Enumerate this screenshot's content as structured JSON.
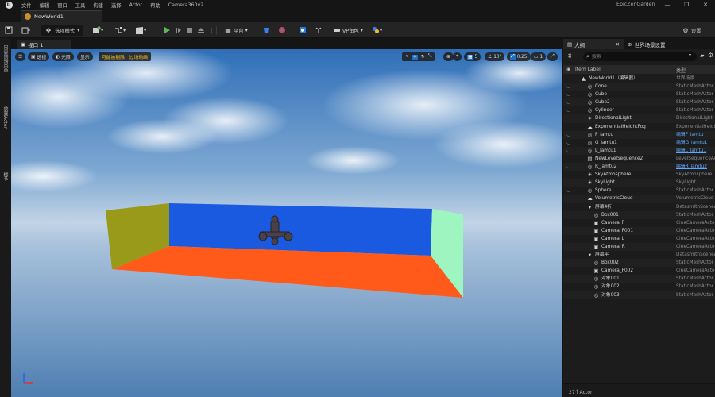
{
  "menubar": {
    "logo": "U",
    "items": [
      "文件",
      "编辑",
      "窗口",
      "工具",
      "构建",
      "选择",
      "Actor",
      "帮助",
      "Camera360v2"
    ],
    "project_name": "EpicZenGarden",
    "window_buttons": [
      "—",
      "❐",
      "✕"
    ]
  },
  "level_tab": {
    "label": "NewWorld1"
  },
  "toolbar": {
    "mode_label": "选项模式",
    "platform_label": "平台",
    "vp_label": "VP角色",
    "settings_label": "设置"
  },
  "left_panel": {
    "tabs": [
      "内容侧滑菜单",
      "放置Actor",
      "细节"
    ]
  },
  "viewport": {
    "tab_label": "视口 1",
    "perspective_label": "透视",
    "lit_label": "光照",
    "show_label": "显示",
    "warning_label": "可能被剔除：过场动画",
    "grid_value": "5",
    "angle_value": "10°",
    "scale_value": "0.25",
    "camera_speed": "1"
  },
  "outliner": {
    "tab_label": "大纲",
    "world_settings_tab": "世界场景设置",
    "search_placeholder": "搜索",
    "col_label": "Item Label",
    "col_type": "类型",
    "rows": [
      {
        "name": "NewWorld1（编辑器）",
        "type": "世界场景",
        "indent": 1,
        "eye": false,
        "icon": "▲",
        "link": false
      },
      {
        "name": "Cone",
        "type": "StaticMeshActor",
        "indent": 2,
        "eye": true,
        "icon": "◎",
        "link": false
      },
      {
        "name": "Cube",
        "type": "StaticMeshActor",
        "indent": 2,
        "eye": true,
        "icon": "◎",
        "link": false
      },
      {
        "name": "Cube2",
        "type": "StaticMeshActor",
        "indent": 2,
        "eye": true,
        "icon": "◎",
        "link": false
      },
      {
        "name": "Cylinder",
        "type": "StaticMeshActor",
        "indent": 2,
        "eye": true,
        "icon": "◎",
        "link": false
      },
      {
        "name": "DirectionalLight",
        "type": "DirectionalLight",
        "indent": 2,
        "eye": false,
        "icon": "✶",
        "link": false
      },
      {
        "name": "ExponentialHeightFog",
        "type": "ExponentialHeigh",
        "indent": 2,
        "eye": false,
        "icon": "☁",
        "link": false
      },
      {
        "name": "F_lamtu",
        "type": "编辑F_lamtu",
        "indent": 2,
        "eye": true,
        "icon": "◎",
        "link": true
      },
      {
        "name": "G_lamtu1",
        "type": "编辑G_lamtu1",
        "indent": 2,
        "eye": true,
        "icon": "◎",
        "link": true
      },
      {
        "name": "L_lamtu1",
        "type": "编辑L_lamtu1",
        "indent": 2,
        "eye": true,
        "icon": "◎",
        "link": true
      },
      {
        "name": "NewLevelSequence2",
        "type": "LevelSequenceAc",
        "indent": 2,
        "eye": false,
        "icon": "▤",
        "link": false
      },
      {
        "name": "R_lamtu2",
        "type": "编辑R_lamtu2",
        "indent": 2,
        "eye": true,
        "icon": "◎",
        "link": true
      },
      {
        "name": "SkyAtmosphere",
        "type": "SkyAtmosphere",
        "indent": 2,
        "eye": false,
        "icon": "☀",
        "link": false
      },
      {
        "name": "SkyLight",
        "type": "SkyLight",
        "indent": 2,
        "eye": false,
        "icon": "☀",
        "link": false
      },
      {
        "name": "Sphere",
        "type": "StaticMeshActor",
        "indent": 2,
        "eye": true,
        "icon": "◎",
        "link": false
      },
      {
        "name": "VolumetricCloud",
        "type": "VolumetricCloud",
        "indent": 2,
        "eye": false,
        "icon": "☁",
        "link": false
      },
      {
        "name": "屏幕4折",
        "type": "DatasmithSceneA",
        "indent": 2,
        "eye": false,
        "icon": "▾",
        "link": false
      },
      {
        "name": "Box001",
        "type": "StaticMeshActor",
        "indent": 3,
        "eye": false,
        "icon": "◎",
        "link": false
      },
      {
        "name": "Camera_F",
        "type": "CineCameraActor",
        "indent": 3,
        "eye": false,
        "icon": "▣",
        "link": false
      },
      {
        "name": "Camera_F001",
        "type": "CineCameraActor",
        "indent": 3,
        "eye": false,
        "icon": "▣",
        "link": false
      },
      {
        "name": "Camera_L",
        "type": "CineCameraActor",
        "indent": 3,
        "eye": false,
        "icon": "▣",
        "link": false
      },
      {
        "name": "Camera_R",
        "type": "CineCameraActor",
        "indent": 3,
        "eye": false,
        "icon": "▣",
        "link": false
      },
      {
        "name": "屏幕平",
        "type": "DatasmithSceneA",
        "indent": 2,
        "eye": false,
        "icon": "▾",
        "link": false
      },
      {
        "name": "Box002",
        "type": "StaticMeshActor",
        "indent": 3,
        "eye": false,
        "icon": "◎",
        "link": false
      },
      {
        "name": "Camera_F002",
        "type": "CineCameraActor",
        "indent": 3,
        "eye": false,
        "icon": "▣",
        "link": false
      },
      {
        "name": "对象001",
        "type": "StaticMeshActor",
        "indent": 3,
        "eye": false,
        "icon": "◎",
        "link": false
      },
      {
        "name": "对象002",
        "type": "StaticMeshActor",
        "indent": 3,
        "eye": false,
        "icon": "◎",
        "link": false
      },
      {
        "name": "对象003",
        "type": "StaticMeshActor",
        "indent": 3,
        "eye": false,
        "icon": "◎",
        "link": false
      }
    ],
    "footer": "27个Actor"
  },
  "colors": {
    "accent": "#1e6fc8",
    "play": "#5cb85c",
    "warning": "#f3c11f",
    "wall_yellow": "#9a9a1a",
    "wall_blue": "#1a5ae0",
    "wall_green": "#9ef5c0",
    "floor_orange": "#ff5a1a"
  }
}
